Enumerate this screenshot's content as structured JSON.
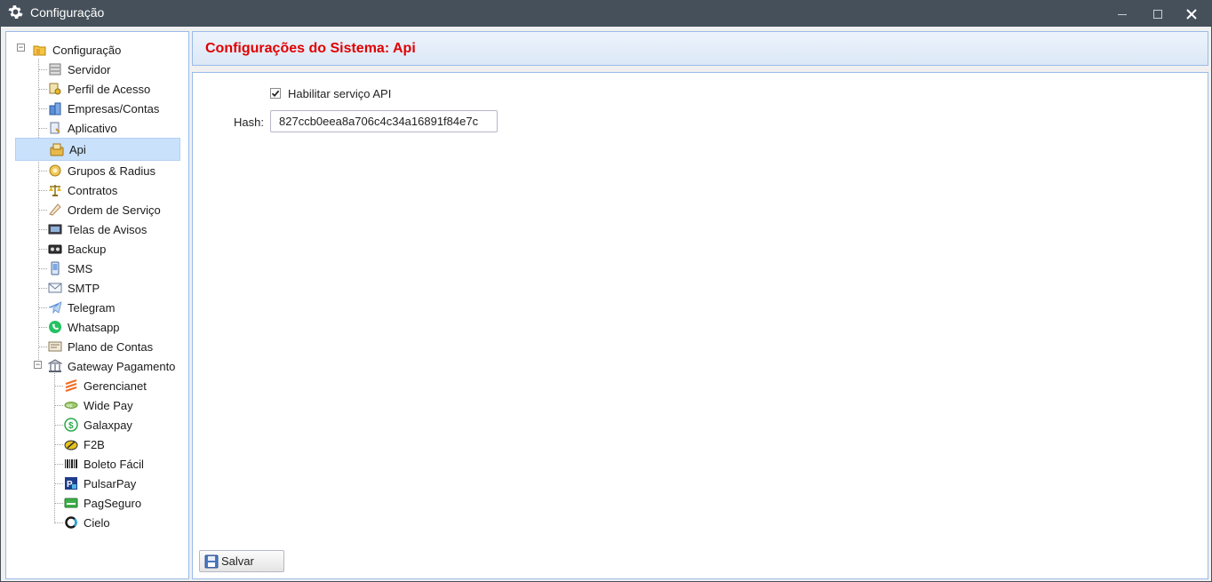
{
  "window": {
    "title": "Configuração",
    "controls": {
      "minimize": "—",
      "maximize": "☐",
      "close": "✕"
    }
  },
  "tree": {
    "root": {
      "label": "Configuração",
      "icon": "folder-config-icon"
    },
    "items": [
      {
        "label": "Servidor",
        "icon": "server-icon"
      },
      {
        "label": "Perfil de Acesso",
        "icon": "access-profile-icon"
      },
      {
        "label": "Empresas/Contas",
        "icon": "companies-icon"
      },
      {
        "label": "Aplicativo",
        "icon": "application-icon"
      },
      {
        "label": "Api",
        "icon": "api-icon",
        "selected": true
      },
      {
        "label": "Grupos & Radius",
        "icon": "groups-radius-icon"
      },
      {
        "label": "Contratos",
        "icon": "scales-icon"
      },
      {
        "label": "Ordem de Serviço",
        "icon": "service-order-icon"
      },
      {
        "label": "Telas de Avisos",
        "icon": "notice-screen-icon"
      },
      {
        "label": "Backup",
        "icon": "backup-icon"
      },
      {
        "label": "SMS",
        "icon": "sms-icon"
      },
      {
        "label": "SMTP",
        "icon": "smtp-envelope-icon"
      },
      {
        "label": "Telegram",
        "icon": "telegram-icon"
      },
      {
        "label": "Whatsapp",
        "icon": "whatsapp-icon"
      },
      {
        "label": "Plano de Contas",
        "icon": "chart-of-accounts-icon"
      },
      {
        "label": "Gateway Pagamento",
        "icon": "bank-icon"
      }
    ],
    "gateway_children": [
      {
        "label": "Gerencianet",
        "icon": "gerencianet-icon"
      },
      {
        "label": "Wide Pay",
        "icon": "widepay-icon"
      },
      {
        "label": "Galaxpay",
        "icon": "galaxpay-icon"
      },
      {
        "label": "F2B",
        "icon": "f2b-icon"
      },
      {
        "label": "Boleto Fácil",
        "icon": "barcode-icon"
      },
      {
        "label": "PulsarPay",
        "icon": "pulsarpay-icon"
      },
      {
        "label": "PagSeguro",
        "icon": "pagseguro-icon"
      },
      {
        "label": "Cielo",
        "icon": "cielo-icon"
      }
    ]
  },
  "panel": {
    "title": "Configurações do Sistema: Api",
    "enable_api": {
      "label": "Habilitar serviço API",
      "checked": true
    },
    "hash": {
      "label": "Hash:",
      "value": "827ccb0eea8a706c4c34a16891f84e7c"
    },
    "save_label": "Salvar"
  },
  "colors": {
    "title_red": "#e00000",
    "titlebar": "#46505a",
    "panel_border": "#99bbe8",
    "selection": "#c9e1fb"
  }
}
